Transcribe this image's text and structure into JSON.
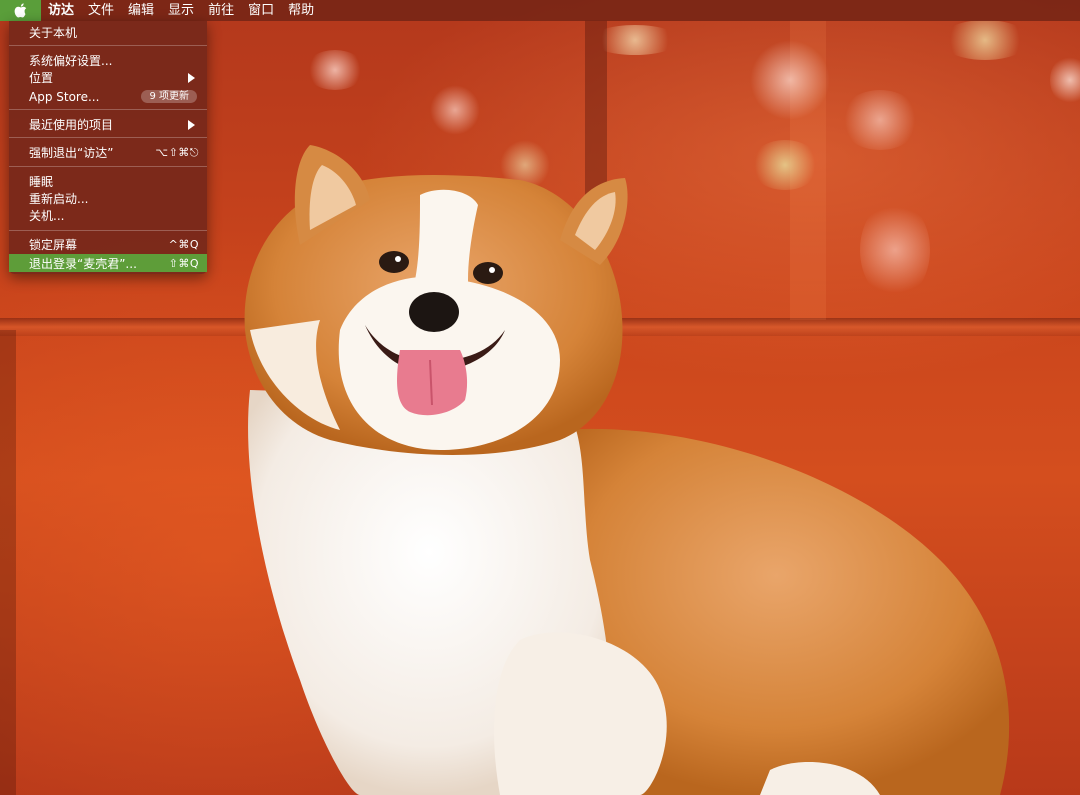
{
  "menubar": {
    "apple_icon": "apple-icon",
    "items": [
      "访达",
      "文件",
      "编辑",
      "显示",
      "前往",
      "窗口",
      "帮助"
    ]
  },
  "apple_menu": {
    "about": "关于本机",
    "system_prefs": "系统偏好设置...",
    "location": "位置",
    "app_store": "App Store...",
    "app_store_badge": "9 项更新",
    "recent_items": "最近使用的项目",
    "force_quit": "强制退出“访达”",
    "force_quit_shortcut": "⌥⇧⌘⎋",
    "sleep": "睡眠",
    "restart": "重新启动...",
    "shutdown": "关机...",
    "lock_screen": "锁定屏幕",
    "lock_shortcut": "^⌘Q",
    "logout": "退出登录“麦壳君”...",
    "logout_shortcut": "⇧⌘Q"
  },
  "colors": {
    "accent": "#5e9d39",
    "menu_bg": "#76281a",
    "wallpaper": "#c9441c"
  }
}
